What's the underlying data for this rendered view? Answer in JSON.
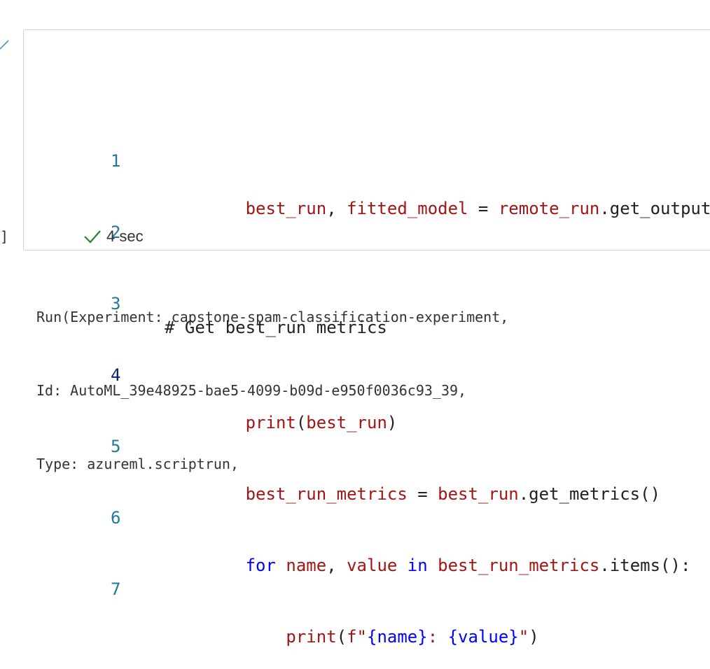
{
  "cell": {
    "line_numbers": [
      "1",
      "2",
      "3",
      "4",
      "5",
      "6",
      "7"
    ],
    "code": {
      "l1": {
        "a": "best_run",
        "b": ", ",
        "c": "fitted_model",
        "d": " = ",
        "e": "remote_run",
        "f": ".get_output()"
      },
      "l3": {
        "comment": "# Get best_run metrics"
      },
      "l4": {
        "a": "print",
        "b": "(",
        "c": "best_run",
        "d": ")"
      },
      "l5": {
        "a": "best_run_metrics",
        "b": " = ",
        "c": "best_run",
        "d": ".get_metrics()"
      },
      "l6": {
        "kw1": "for",
        "a": " name",
        "b": ", ",
        "c": "value",
        "kw2": " in ",
        "d": "best_run_metrics",
        "e": ".items():"
      },
      "l7": {
        "indent": "    ",
        "a": "print",
        "b": "(",
        "c": "f\"",
        "d": "{name}",
        "e": ": ",
        "f": "{value}",
        "g": "\"",
        "h": ")"
      }
    },
    "status": {
      "check_icon": "check-icon",
      "duration": "4 sec"
    },
    "bracket": "]"
  },
  "output": {
    "lines": [
      "Run(Experiment: capstone-spam-classification-experiment,",
      "Id: AutoML_39e48925-bae5-4099-b09d-e950f0036c93_39,",
      "Type: azureml.scriptrun,"
    ]
  },
  "colors": {
    "keyword": "#0000ff",
    "identifier": "#a31515",
    "line_number": "#237893",
    "success": "#2e7d32"
  }
}
